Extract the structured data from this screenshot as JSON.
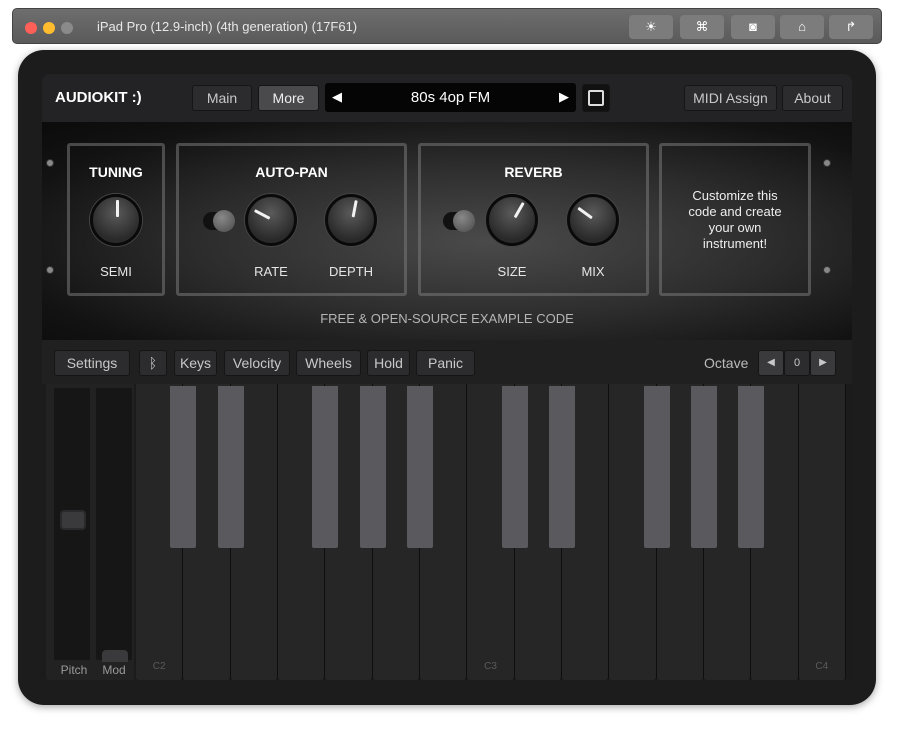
{
  "window": {
    "title": "iPad Pro (12.9-inch) (4th generation) (17F61)",
    "buttons": [
      "brightness-icon",
      "keyboard-icon",
      "screenshot-icon",
      "home-icon",
      "rotate-icon"
    ]
  },
  "header": {
    "app_name": "AUDIOKIT :)",
    "tabs": [
      {
        "label": "Main",
        "active": false
      },
      {
        "label": "More",
        "active": true
      }
    ],
    "preset": "80s 4op FM",
    "midi_assign": "MIDI Assign",
    "about": "About"
  },
  "panel": {
    "tuning": {
      "title": "TUNING",
      "knobs": [
        {
          "label": "SEMI",
          "value": 0.5
        }
      ]
    },
    "autopan": {
      "title": "AUTO-PAN",
      "toggle_on": false,
      "knobs": [
        {
          "label": "RATE",
          "value": 0.27
        },
        {
          "label": "DEPTH",
          "value": 0.54
        }
      ]
    },
    "reverb": {
      "title": "REVERB",
      "toggle_on": false,
      "knobs": [
        {
          "label": "SIZE",
          "value": 0.61
        },
        {
          "label": "MIX",
          "value": 0.3
        }
      ]
    },
    "custom_text": "Customize this code and create your own instrument!",
    "footer": "FREE & OPEN-SOURCE EXAMPLE CODE"
  },
  "toolbar": {
    "settings": "Settings",
    "bluetooth_icon": "bluetooth-icon",
    "keys": "Keys",
    "velocity": "Velocity",
    "wheels": "Wheels",
    "hold": "Hold",
    "panic": "Panic",
    "octave_label": "Octave",
    "octave_value": "0"
  },
  "keyboard": {
    "pitch_label": "Pitch",
    "mod_label": "Mod",
    "note_labels": {
      "0": "C2",
      "7": "C3",
      "14": "C4"
    },
    "white_keys": 15
  },
  "colors": {
    "background": "#1a1a1a",
    "black_key": "#5a5a5e",
    "white_key": "#262626"
  }
}
